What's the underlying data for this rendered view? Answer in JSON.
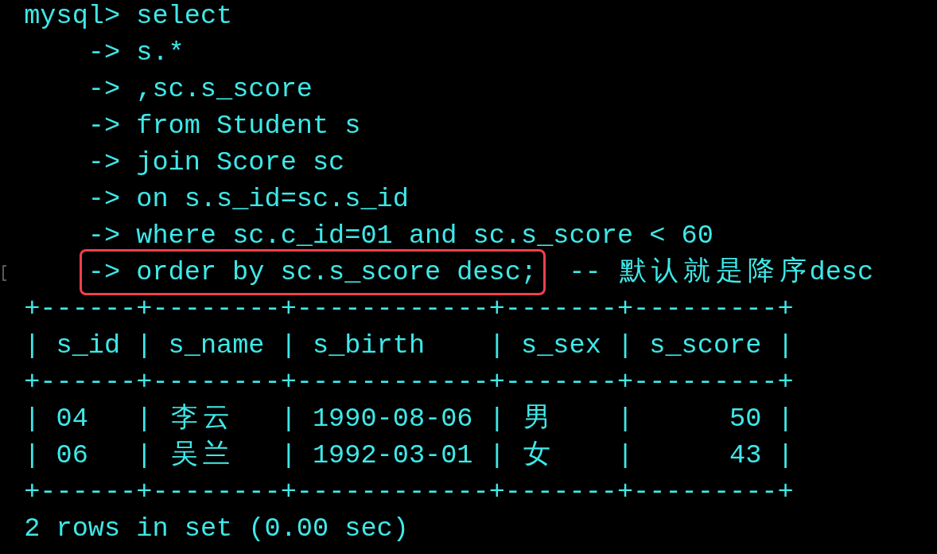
{
  "terminal": {
    "lines": [
      {
        "kind": "prompt",
        "text": "mysql> select"
      },
      {
        "kind": "continuation",
        "text": "-> s.*"
      },
      {
        "kind": "continuation",
        "text": "-> ,sc.s_score"
      },
      {
        "kind": "continuation",
        "text": "-> from Student s"
      },
      {
        "kind": "continuation",
        "text": "-> join Score sc"
      },
      {
        "kind": "continuation",
        "text": "-> on s.s_id=sc.s_id"
      },
      {
        "kind": "continuation",
        "text": "-> where sc.c_id=01 and sc.s_score < 60"
      },
      {
        "kind": "continuation",
        "text": "-> order by sc.s_score desc;",
        "comment": "-- 默认就是降序desc",
        "highlighted": true,
        "marked": true
      },
      {
        "kind": "table",
        "text": "+------+--------+------------+-------+---------+"
      },
      {
        "kind": "table",
        "text": "| s_id | s_name | s_birth    | s_sex | s_score |"
      },
      {
        "kind": "table",
        "text": "+------+--------+------------+-------+---------+"
      },
      {
        "kind": "table",
        "text": "| 04   | 李云   | 1990-08-06 | 男    |      50 |"
      },
      {
        "kind": "table",
        "text": "| 06   | 吴兰   | 1992-03-01 | 女    |      43 |"
      },
      {
        "kind": "table",
        "text": "+------+--------+------------+-------+---------+"
      },
      {
        "kind": "output",
        "text": "2 rows in set (0.00 sec)"
      }
    ]
  }
}
